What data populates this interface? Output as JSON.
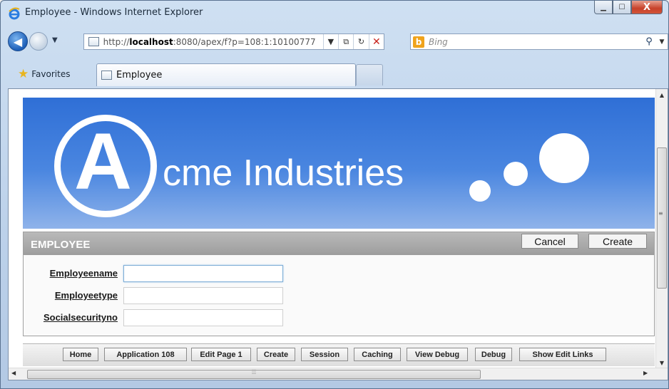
{
  "window": {
    "title": "Employee - Windows Internet Explorer",
    "controls": {
      "minimize": "▁",
      "maximize": "☐",
      "close": "X"
    }
  },
  "navigation": {
    "url_prefix": "http://",
    "url_host": "localhost",
    "url_rest": ":8080/apex/f?p=108:1:10100777",
    "search_placeholder": "Bing",
    "search_engine_logo": "b"
  },
  "favorites_bar": {
    "favorites_label": "Favorites",
    "tab_title": "Employee"
  },
  "banner": {
    "logo_letter": "A",
    "company_text": "cme Industries"
  },
  "region": {
    "title": "EMPLOYEE",
    "buttons": {
      "cancel": "Cancel",
      "create": "Create"
    },
    "fields": [
      {
        "label": "Employeename",
        "value": ""
      },
      {
        "label": "Employeetype",
        "value": ""
      },
      {
        "label": "Socialsecurityno",
        "value": ""
      }
    ]
  },
  "developer_toolbar": {
    "buttons": [
      "Home",
      "Application 108",
      "Edit Page 1",
      "Create",
      "Session",
      "Caching",
      "View Debug",
      "Debug",
      "Show Edit Links"
    ]
  },
  "icons": {
    "ie_logo": "ie-logo-icon",
    "favorites_star": "star-icon",
    "page": "page-icon",
    "search": "magnifier-icon"
  },
  "colors": {
    "banner_top": "#2f6fd6",
    "banner_bottom": "#8fb3ea",
    "region_header": "#a8a8a8",
    "close_button": "#c7412a"
  }
}
